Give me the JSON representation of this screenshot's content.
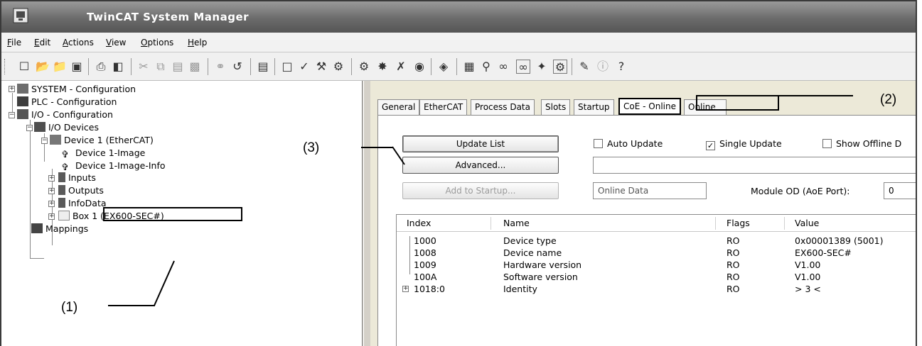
{
  "window": {
    "title": "TwinCAT System Manager"
  },
  "menu": [
    "File",
    "Edit",
    "Actions",
    "View",
    "Options",
    "Help"
  ],
  "toolbar_icons": [
    "new-icon",
    "open-icon",
    "open-folder-icon",
    "save-icon",
    "print-icon",
    "print-preview-icon",
    "cut-icon",
    "copy-icon",
    "paste-icon",
    "paste-link-icon",
    "find-icon",
    "replace-icon",
    "device-icon",
    "activate-config-icon",
    "check-icon",
    "build-icon",
    "target-icon",
    "scan-icon",
    "network-icon",
    "tools-icon",
    "settings-icon",
    "zoom-icon",
    "properties-icon",
    "search-icon",
    "link-icon",
    "free-run-icon",
    "mappings-icon",
    "config-mode-icon",
    "edit-icon",
    "info-icon",
    "help-icon"
  ],
  "tree": {
    "system": "SYSTEM - Configuration",
    "plc": "PLC - Configuration",
    "io": "I/O - Configuration",
    "io_devices": "I/O Devices",
    "device1": "Device 1 (EtherCAT)",
    "device1_image": "Device 1-Image",
    "device1_image_info": "Device 1-Image-Info",
    "inputs": "Inputs",
    "outputs": "Outputs",
    "infodata": "InfoData",
    "box1": "Box 1 (EX600-SEC#)",
    "mappings": "Mappings"
  },
  "tabs": [
    "General",
    "EtherCAT",
    "Process Data",
    "Slots",
    "Startup",
    "CoE - Online",
    "Online"
  ],
  "active_tab": "CoE - Online",
  "panel": {
    "update_list": "Update List",
    "advanced": "Advanced...",
    "add_to_startup": "Add to Startup...",
    "auto_update": "Auto Update",
    "single_update": "Single Update",
    "show_offline": "Show Offline D",
    "online_data": "Online Data",
    "module_od_label": "Module OD (AoE Port):",
    "module_od_value": "0",
    "auto_update_checked": false,
    "single_update_checked": true,
    "show_offline_checked": false
  },
  "grid": {
    "headers": [
      "Index",
      "Name",
      "Flags",
      "Value"
    ],
    "rows": [
      {
        "index": "1000",
        "name": "Device type",
        "flags": "RO",
        "value": "0x00001389 (5001)"
      },
      {
        "index": "1008",
        "name": "Device name",
        "flags": "RO",
        "value": "EX600-SEC#"
      },
      {
        "index": "1009",
        "name": "Hardware version",
        "flags": "RO",
        "value": "V1.00"
      },
      {
        "index": "100A",
        "name": "Software version",
        "flags": "RO",
        "value": "V1.00"
      },
      {
        "index": "1018:0",
        "name": "Identity",
        "flags": "RO",
        "value": "> 3 <"
      }
    ]
  },
  "callouts": {
    "c1": "(1)",
    "c2": "(2)",
    "c3": "(3)"
  }
}
